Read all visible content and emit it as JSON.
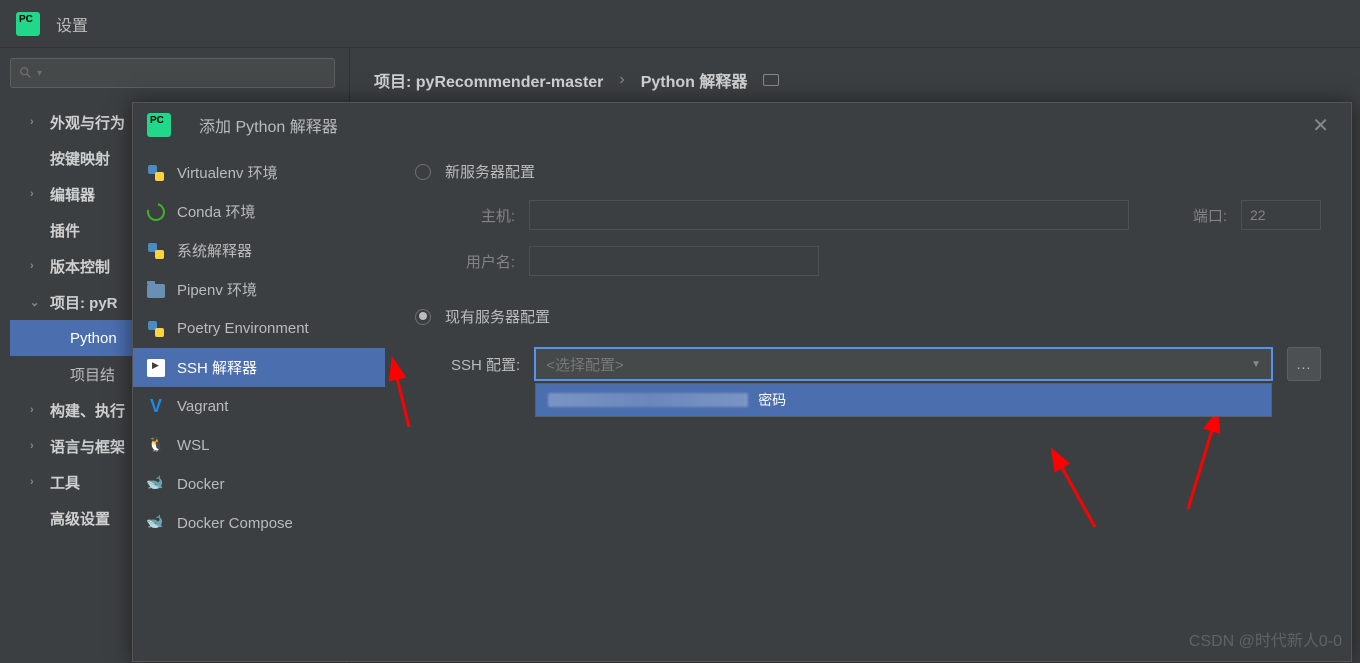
{
  "settings": {
    "title": "设置",
    "search_placeholder": "",
    "tree": {
      "appearance": "外观与行为",
      "keymap": "按键映射",
      "editor": "编辑器",
      "plugins": "插件",
      "version_control": "版本控制",
      "project": "项目: pyR",
      "python_interp": "Python",
      "project_struct": "项目结",
      "build": "构建、执行",
      "languages": "语言与框架",
      "tools": "工具",
      "advanced": "高级设置"
    },
    "breadcrumb": {
      "project": "项目: pyRecommender-master",
      "separator": "›",
      "page": "Python 解释器"
    }
  },
  "modal": {
    "title": "添加 Python 解释器",
    "interpreters": {
      "virtualenv": "Virtualenv 环境",
      "conda": "Conda 环境",
      "system": "系统解释器",
      "pipenv": "Pipenv 环境",
      "poetry": "Poetry Environment",
      "ssh": "SSH 解释器",
      "vagrant": "Vagrant",
      "wsl": "WSL",
      "docker": "Docker",
      "docker_compose": "Docker Compose"
    },
    "form": {
      "new_server": "新服务器配置",
      "existing_server": "现有服务器配置",
      "host_label": "主机:",
      "user_label": "用户名:",
      "port_label": "端口:",
      "port_value": "22",
      "ssh_config_label": "SSH 配置:",
      "ssh_placeholder": "<选择配置>",
      "more_btn": "...",
      "option_suffix": "密码"
    }
  },
  "watermark": "CSDN @时代新人0-0"
}
